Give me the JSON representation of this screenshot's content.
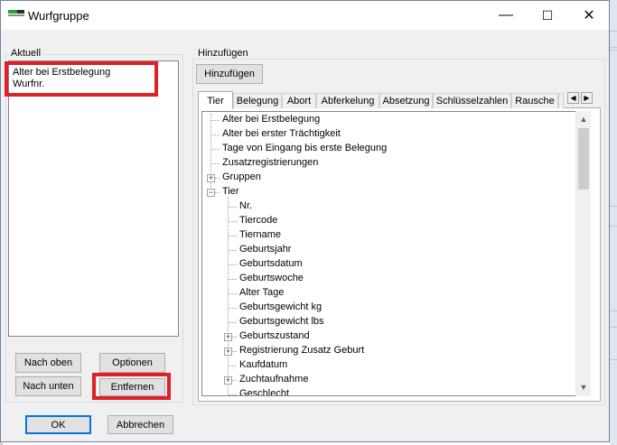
{
  "window": {
    "title": "Wurfgruppe"
  },
  "titlebar": {
    "minimize": "—",
    "maximize": "☐",
    "close": "✕"
  },
  "aktuell": {
    "group_label": "Aktuell",
    "items": [
      "Alter bei Erstbelegung",
      "Wurfnr."
    ],
    "buttons": {
      "up": "Nach oben",
      "down": "Nach unten",
      "options": "Optionen",
      "remove": "Entfernen"
    }
  },
  "hinzufuegen": {
    "group_label": "Hinzufügen",
    "button": "Hinzufügen",
    "tabs": [
      "Tier",
      "Belegung",
      "Abort",
      "Abferkelung",
      "Absetzung",
      "Schlüsselzahlen",
      "Rausche"
    ],
    "active_tab": "Tier",
    "tree_top": [
      "Alter bei Erstbelegung",
      "Alter bei erster Trächtigkeit",
      "Tage von Eingang bis erste Belegung",
      "Zusatzregistrierungen"
    ],
    "tree_groups": "Gruppen",
    "tree_tier": "Tier",
    "tree_tier_children": [
      "Nr.",
      "Tiercode",
      "Tiername",
      "Geburtsjahr",
      "Geburtsdatum",
      "Geburtswoche",
      "Alter Tage",
      "Geburtsgewicht kg",
      "Geburtsgewicht lbs",
      "Geburtszustand",
      "Registrierung Zusatz Geburt",
      "Kaufdatum",
      "Zuchtaufnahme",
      "Geschlecht"
    ],
    "expandable_children": [
      "Geburtszustand",
      "Registrierung Zusatz Geburt",
      "Zuchtaufnahme"
    ]
  },
  "footer": {
    "ok": "OK",
    "cancel": "Abbrechen"
  },
  "colors": {
    "highlight": "#e01f26",
    "accent": "#0078d7"
  }
}
